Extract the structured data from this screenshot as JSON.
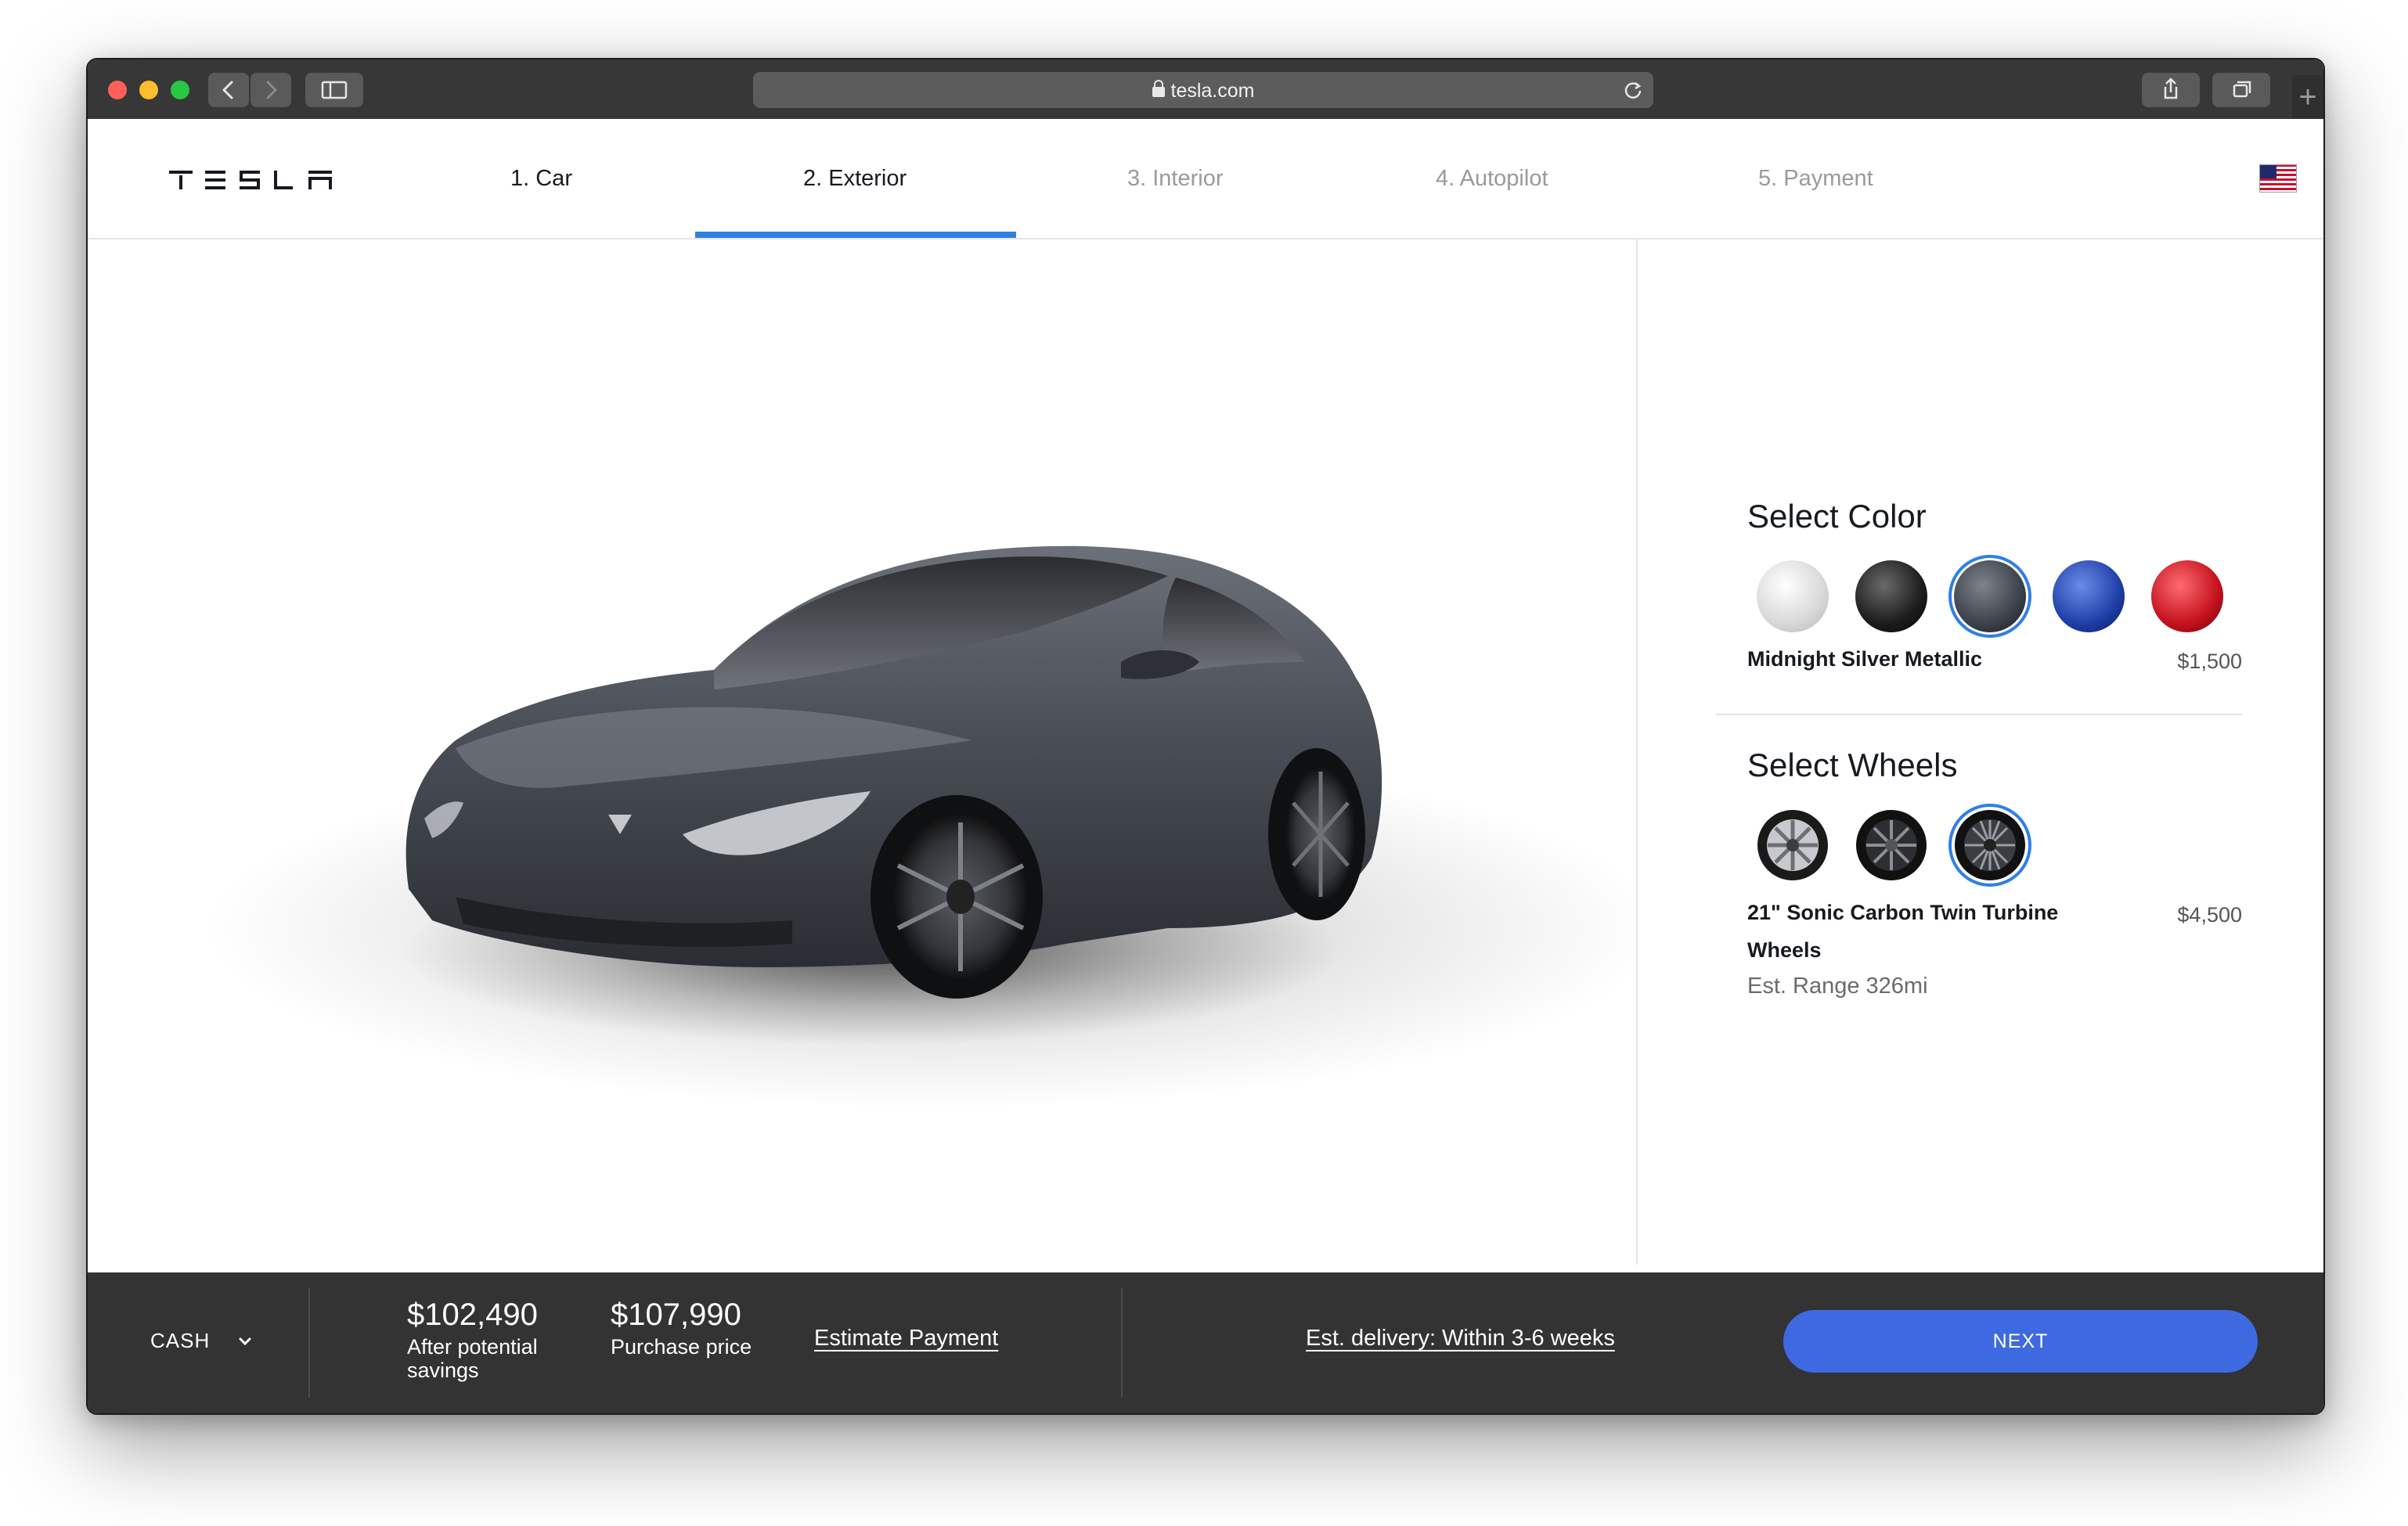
{
  "browser": {
    "url": "tesla.com"
  },
  "brand": {
    "logo_text": "TESLA"
  },
  "steps": [
    {
      "label": "1. Car"
    },
    {
      "label": "2. Exterior"
    },
    {
      "label": "3. Interior"
    },
    {
      "label": "4. Autopilot"
    },
    {
      "label": "5. Payment"
    }
  ],
  "active_step": "2. Exterior",
  "colors_ui": {
    "accent": "#2f7fe6",
    "next_button": "#3e6ae1",
    "footer_bg": "#333333"
  },
  "color_section": {
    "title": "Select Color",
    "swatches": [
      {
        "name": "white-swatch",
        "hex": "#e8e8e8"
      },
      {
        "name": "black-swatch",
        "hex": "#1c1c1c"
      },
      {
        "name": "midnight-silver-swatch",
        "hex": "#3d424a",
        "selected": true
      },
      {
        "name": "blue-swatch",
        "hex": "#1f3fa8"
      },
      {
        "name": "red-swatch",
        "hex": "#c4121e"
      }
    ],
    "selected_name": "Midnight Silver Metallic",
    "selected_price": "$1,500"
  },
  "wheel_section": {
    "title": "Select Wheels",
    "wheels": [
      {
        "name": "wheel-option-1"
      },
      {
        "name": "wheel-option-2"
      },
      {
        "name": "wheel-option-3",
        "selected": true
      }
    ],
    "selected_name": "21\" Sonic Carbon Twin Turbine Wheels",
    "selected_price": "$4,500",
    "range": "Est. Range 326mi"
  },
  "footer": {
    "payment_mode": "CASH",
    "savings_price": "$102,490",
    "savings_label": "After potential savings",
    "purchase_price": "$107,990",
    "purchase_label": "Purchase price",
    "estimate_link": "Estimate Payment",
    "delivery": "Est. delivery: Within 3-6 weeks",
    "next_label": "NEXT"
  }
}
